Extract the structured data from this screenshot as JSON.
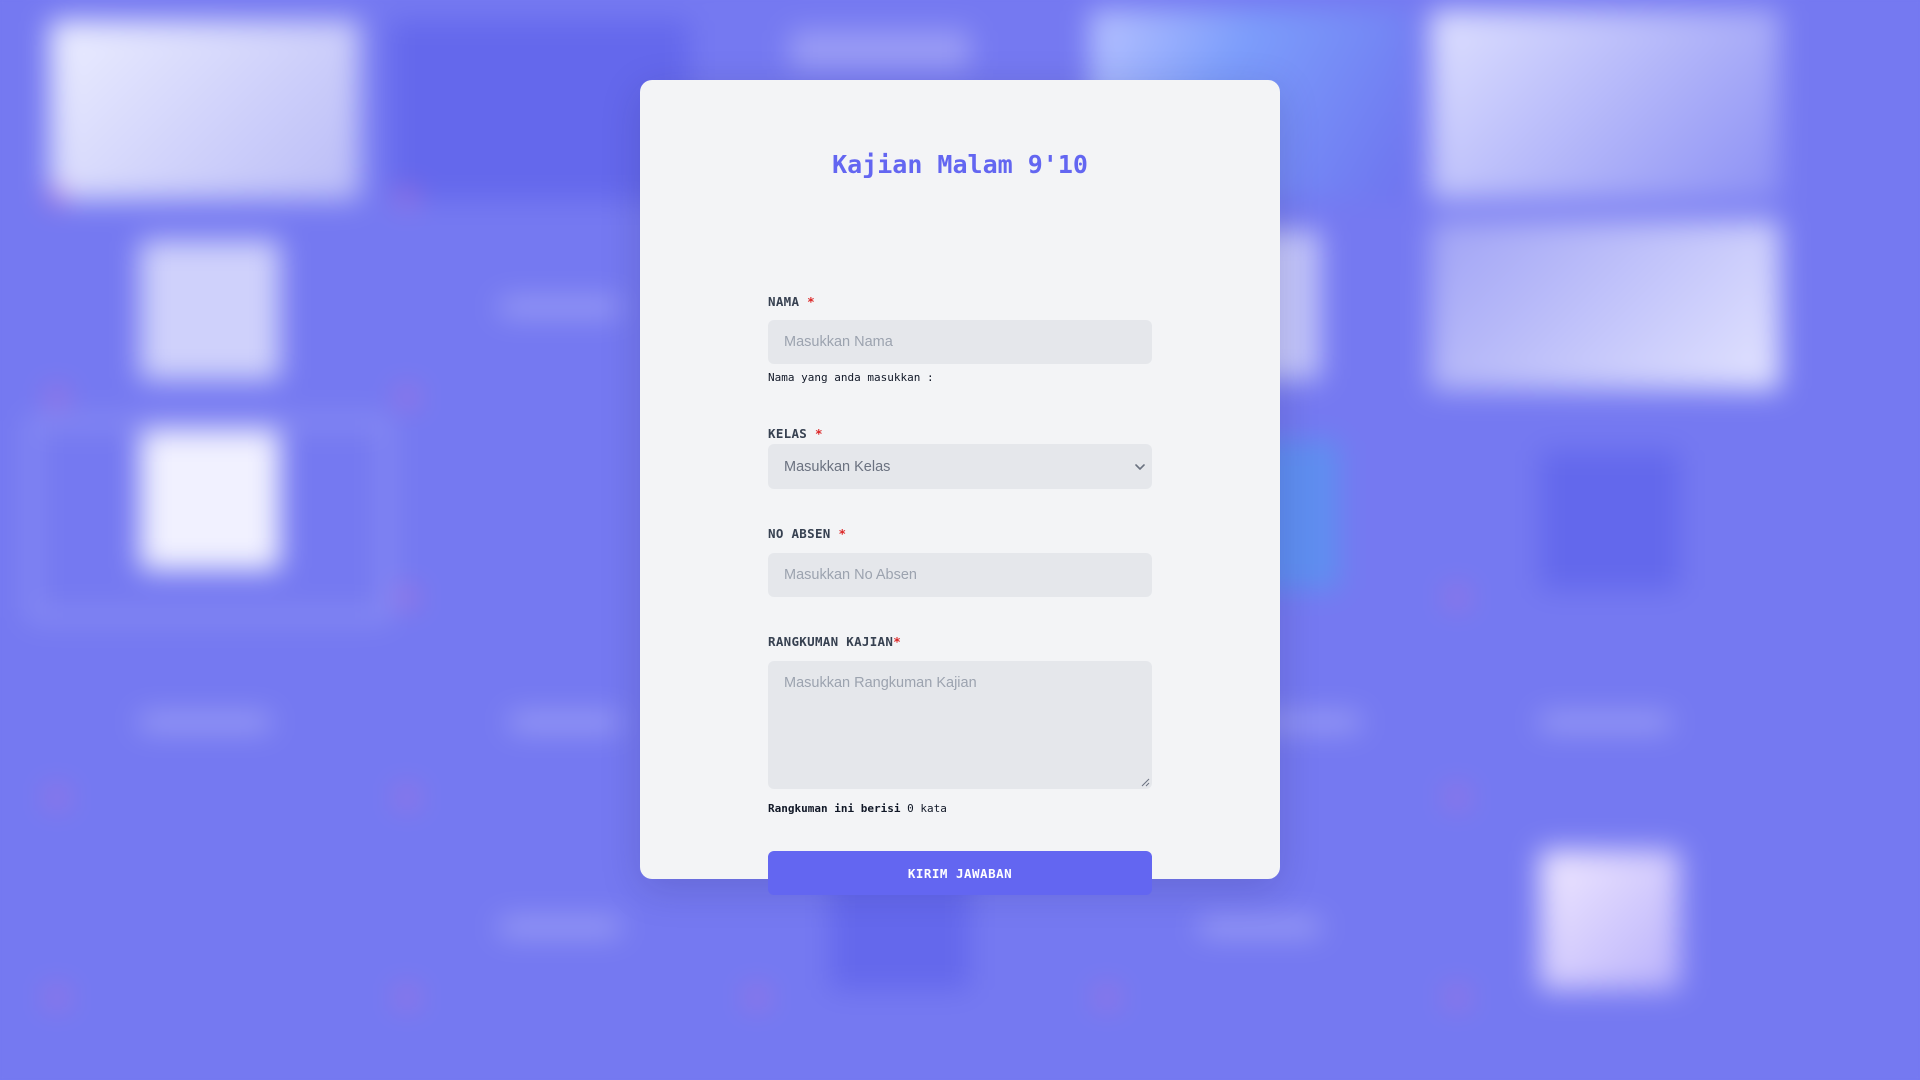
{
  "form": {
    "title": "Kajian Malam 9'10",
    "nama": {
      "label": "NAMA",
      "required_mark": "*",
      "placeholder": "Masukkan Nama",
      "hint": "Nama yang anda masukkan :"
    },
    "kelas": {
      "label": "KELAS",
      "required_mark": "*",
      "placeholder": "Masukkan Kelas"
    },
    "no_absen": {
      "label": "NO ABSEN",
      "required_mark": "*",
      "placeholder": "Masukkan No Absen"
    },
    "rangkuman": {
      "label": "RANGKUMAN KAJIAN",
      "required_mark": "*",
      "placeholder": "Masukkan Rangkuman Kajian",
      "count_prefix": "Rangkuman ini berisi",
      "word_count": "0",
      "count_suffix": "kata"
    },
    "submit_label": "KIRIM JAWABAN"
  },
  "colors": {
    "accent": "#6366f1",
    "background": "#7377f0",
    "card": "#f3f4f6",
    "field": "#e5e7eb",
    "required": "#dc2626"
  },
  "icons": {
    "select": "chevron-down-icon",
    "textarea": "resize-handle-icon"
  }
}
